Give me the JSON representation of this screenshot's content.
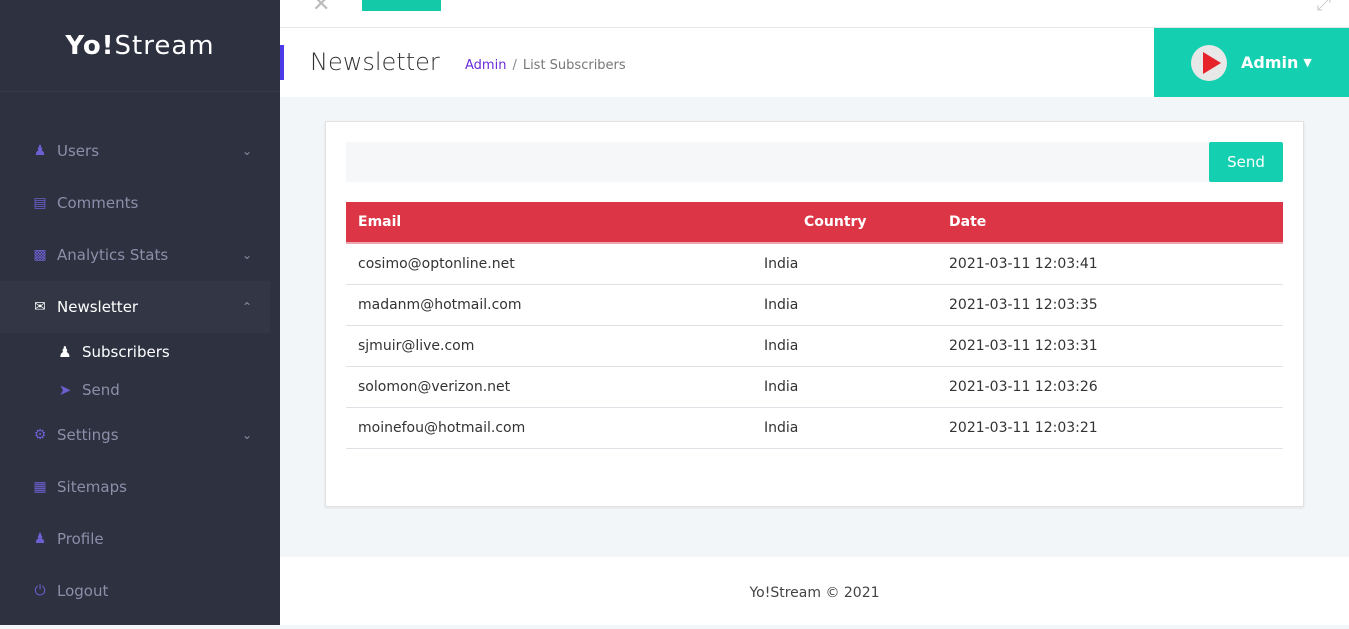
{
  "brand": {
    "bold": "Yo!",
    "rest": "Stream"
  },
  "sidebar": {
    "items": [
      {
        "label": "Users",
        "icon": "user-icon",
        "chevron": "down"
      },
      {
        "label": "Comments",
        "icon": "comment-icon"
      },
      {
        "label": "Analytics Stats",
        "icon": "chart-icon",
        "chevron": "down"
      },
      {
        "label": "Newsletter",
        "icon": "envelope-icon",
        "chevron": "up"
      },
      {
        "label": "Settings",
        "icon": "gear-icon",
        "chevron": "down"
      },
      {
        "label": "Sitemaps",
        "icon": "rss-icon"
      },
      {
        "label": "Profile",
        "icon": "user-icon"
      },
      {
        "label": "Logout",
        "icon": "power-icon"
      }
    ],
    "subitems": [
      {
        "label": "Subscribers",
        "icon": "user-icon"
      },
      {
        "label": "Send",
        "icon": "send-icon"
      }
    ]
  },
  "header": {
    "title": "Newsletter",
    "breadcrumb": [
      "Admin",
      "List Subscribers"
    ],
    "user": "Admin"
  },
  "main": {
    "send_label": "Send",
    "input_value": "",
    "columns": [
      "Email",
      "Country",
      "Date"
    ],
    "rows": [
      [
        "cosimo@optonline.net",
        "India",
        "2021-03-11 12:03:41"
      ],
      [
        "madanm@hotmail.com",
        "India",
        "2021-03-11 12:03:35"
      ],
      [
        "sjmuir@live.com",
        "India",
        "2021-03-11 12:03:31"
      ],
      [
        "solomon@verizon.net",
        "India",
        "2021-03-11 12:03:26"
      ],
      [
        "moinefou@hotmail.com",
        "India",
        "2021-03-11 12:03:21"
      ]
    ]
  },
  "footer": "Yo!Stream © 2021",
  "colors": {
    "accent": "#14cfb0",
    "table_header": "#dc3545",
    "sidebar": "#2d3140"
  }
}
